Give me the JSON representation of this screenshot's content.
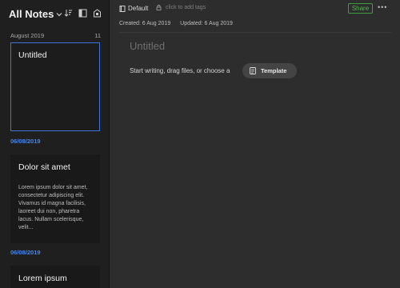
{
  "sidebar": {
    "title": "All Notes",
    "tools": [
      "sort-icon",
      "view-toggle-icon",
      "shortcuts-icon"
    ],
    "month_label": "August 2019",
    "month_count": "11",
    "notes": [
      {
        "title": "Untitled",
        "snippet": "",
        "selected": true
      },
      {
        "date": "06/08/2019",
        "title": "Dolor sit amet",
        "snippet": "Lorem ipsum dolor sit amet, consectetur adipiscing elit. Vivamus id magna facilisis, laoreet dui non, pharetra lacus. Nullam scelerisque, velit..."
      },
      {
        "date": "06/08/2019",
        "title": "Lorem ipsum",
        "snippet": ""
      }
    ]
  },
  "editor": {
    "notebook": "Default",
    "tags_placeholder": "click to add tags",
    "share_label": "Share",
    "more_label": "•••",
    "created": "Created: 6 Aug 2019",
    "updated": "Updated: 6 Aug 2019",
    "title_placeholder": "Untitled",
    "hint": "Start writing, drag files, or choose a",
    "template_label": "Template"
  },
  "colors": {
    "accent": "#4a86e8",
    "share": "#55b455",
    "selected_border": "#3f74d6"
  }
}
